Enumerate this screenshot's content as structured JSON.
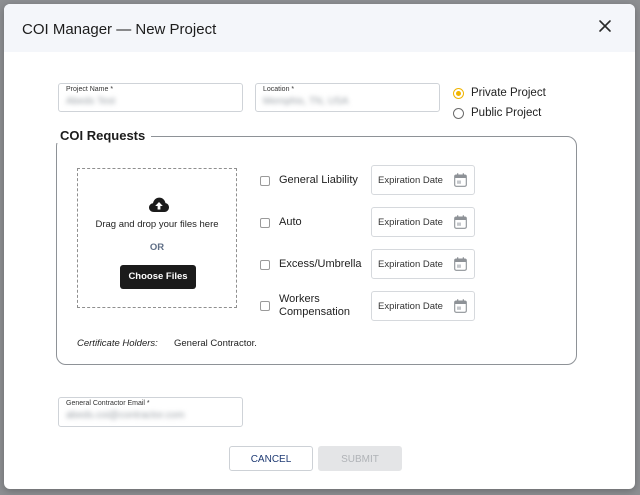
{
  "header": {
    "title": "COI Manager — New Project",
    "close_icon": "close-icon"
  },
  "project_name": {
    "label": "Project Name *",
    "value": "Abeds Test"
  },
  "location": {
    "label": "Location *",
    "value": "Memphis, TN, USA"
  },
  "project_type": {
    "options": [
      {
        "label": "Private Project",
        "checked": true
      },
      {
        "label": "Public Project",
        "checked": false
      }
    ]
  },
  "coi_requests": {
    "legend": "COI Requests",
    "dropzone": {
      "icon": "cloud-upload-icon",
      "text": "Drag and drop your files here",
      "or": "OR",
      "button": "Choose Files"
    },
    "coverages": [
      {
        "label": "General Liability",
        "checked": false,
        "date_placeholder": "Expiration Date"
      },
      {
        "label": "Auto",
        "checked": false,
        "date_placeholder": "Expiration Date"
      },
      {
        "label": "Excess/Umbrella",
        "checked": false,
        "date_placeholder": "Expiration Date"
      },
      {
        "label_line1": "Workers",
        "label_line2": "Compensation",
        "checked": false,
        "date_placeholder": "Expiration Date"
      }
    ],
    "holders_label": "Certificate Holders:",
    "holders_value": "General Contractor."
  },
  "gc_email": {
    "label": "General Contractor Email *",
    "value": "abeds.coi@contractor.com"
  },
  "footer": {
    "cancel": "CANCEL",
    "submit": "SUBMIT"
  },
  "colors": {
    "accent_radio": "#f0b400",
    "primary_button": "#1b1b1b",
    "cancel_text": "#1f3b74"
  }
}
